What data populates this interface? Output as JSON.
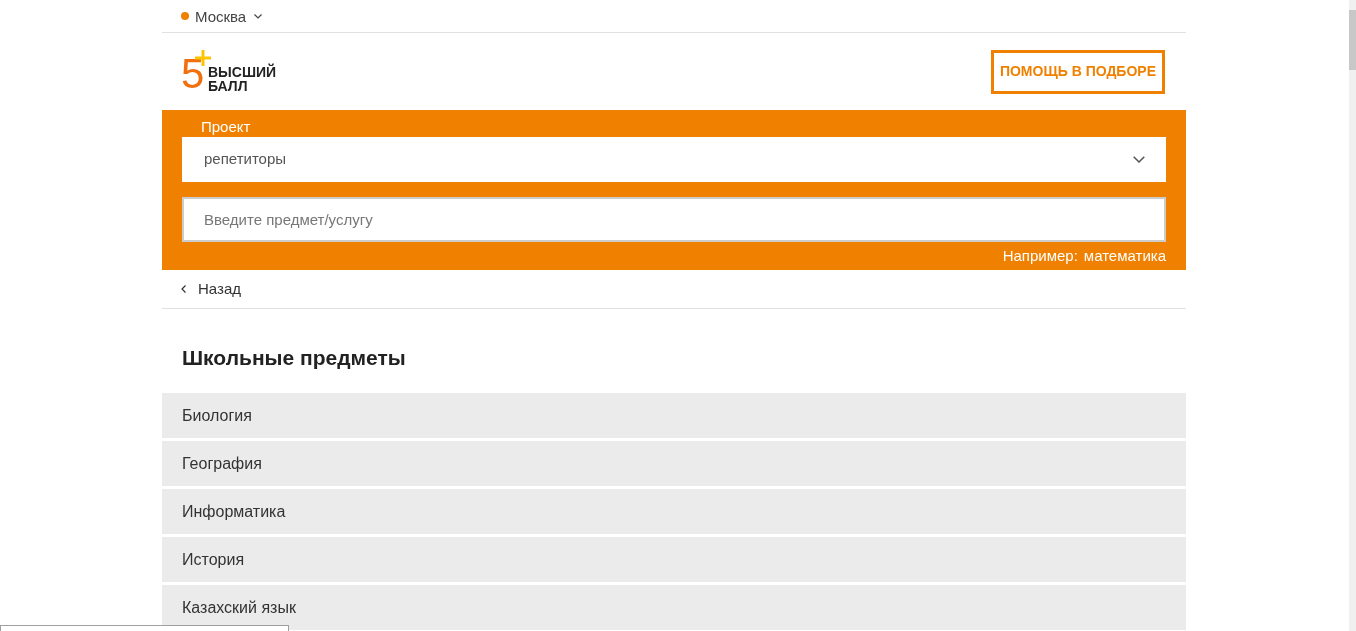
{
  "city": {
    "name": "Москва"
  },
  "header": {
    "logo": {
      "mark": "5",
      "line_1": "ВЫСШИЙ",
      "line_2": "БАЛЛ"
    },
    "help_button": "ПОМОЩЬ В ПОДБОРЕ"
  },
  "search_panel": {
    "project_label": "Проект",
    "project_select": {
      "value": "репетиторы"
    },
    "subject_field": {
      "placeholder": "Введите предмет/услугу"
    },
    "example": {
      "label": "Например:",
      "value": "математика"
    }
  },
  "back_link": {
    "label": "Назад"
  },
  "section": {
    "title": "Школьные предметы",
    "items": [
      "Биология",
      "География",
      "Информатика",
      "История",
      "Казахский язык"
    ]
  }
}
